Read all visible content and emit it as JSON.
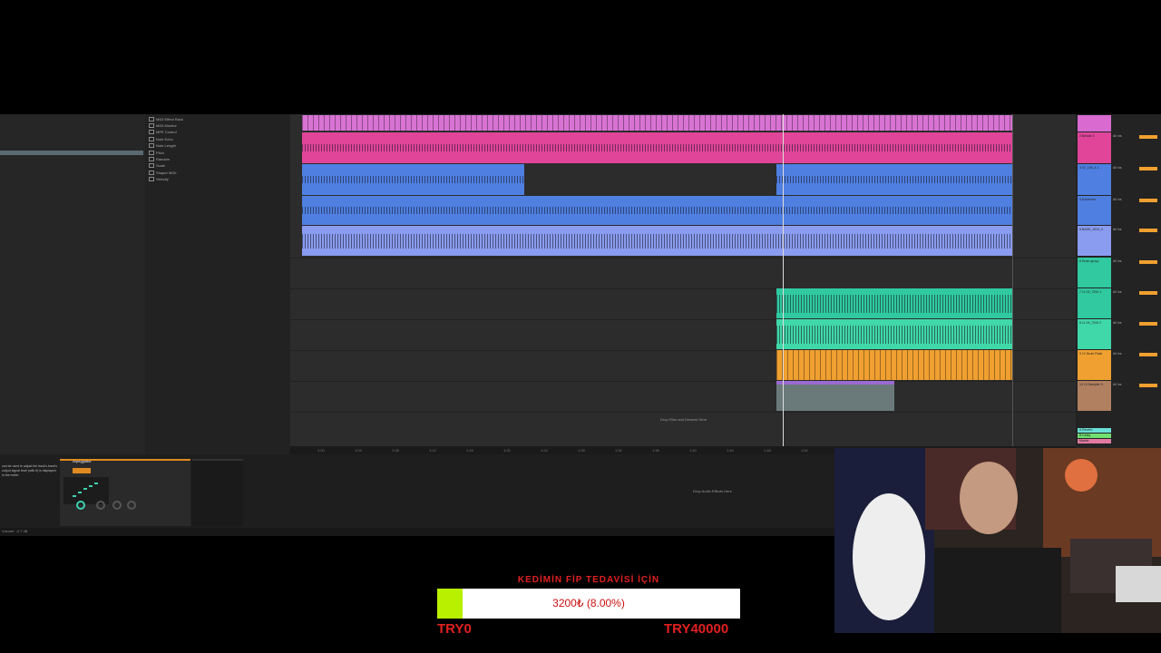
{
  "browser": {
    "items": [
      "MIDI Effect Rack",
      "MIDI Monitor",
      "MPE Control",
      "Note Echo",
      "Note Length",
      "Pitch",
      "Random",
      "Scale",
      "Shaper MIDI",
      "Velocity"
    ]
  },
  "arrangement": {
    "drop_hint": "Drop Files and Devices Here",
    "ruler_ticks": [
      "1:00",
      "1:04",
      "1:08",
      "1:12",
      "1:16",
      "1:20",
      "1:24",
      "1:28",
      "1:32",
      "1:36",
      "1:40",
      "1:44",
      "1:48",
      "1:52",
      "1:56",
      "2:00"
    ]
  },
  "mixer": {
    "tracks": [
      {
        "name": "",
        "color": "#d86ad0"
      },
      {
        "name": "2 Bessle 3",
        "color": "#e0459a"
      },
      {
        "name": "3 47_109_4.1",
        "color": "#4f7fe0"
      },
      {
        "name": "4 Kombiner",
        "color": "#4f7fe0"
      },
      {
        "name": "5 BASS_1024_3",
        "color": "#8a9cf0"
      },
      {
        "name": "6 Drum group",
        "color": "#30c9a0"
      },
      {
        "name": "7 11 09_7200 1",
        "color": "#30c9a0"
      },
      {
        "name": "8 11 09_7200 2",
        "color": "#40d8a8"
      },
      {
        "name": "9 12 Drum Rack",
        "color": "#f0a030"
      },
      {
        "name": "10 13 Sampler 3",
        "color": "#b08060"
      }
    ],
    "returns": [
      "A Reverb",
      "B Delay",
      "Master"
    ],
    "io_label": "All Ins",
    "main_label": "Main"
  },
  "device_view": {
    "info_text": "can be used to adjust the track's track's output signal level (with it) is displayed in the meter.",
    "arp_title": "Arpeggiator",
    "drop_fx": "Drop Audio Effects Here",
    "status": "Volume: -0.7 dB"
  },
  "donation": {
    "title": "KEDİMİN FİP TEDAVİSİ İÇİN",
    "amount_text": "3200₺ (8.00%)",
    "progress": 0.08,
    "min_label": "TRY0",
    "max_label": "TRY40000",
    "title_color": "#e02020",
    "fill_color": "#b8f000"
  }
}
